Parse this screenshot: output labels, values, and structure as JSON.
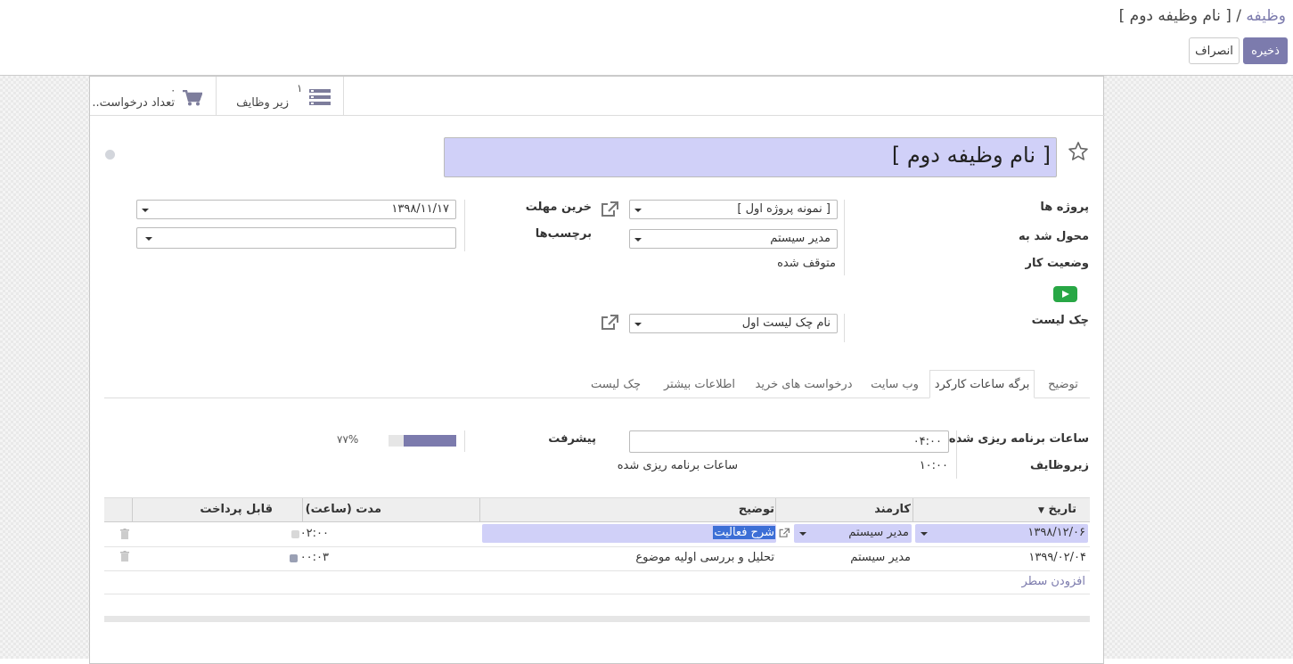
{
  "breadcrumb": {
    "parent": "وظیفه",
    "separator": " / ",
    "current": "[ نام وظیفه دوم ]"
  },
  "buttons": {
    "save": "ذخیره",
    "discard": "انصراف"
  },
  "stat_buttons": [
    {
      "icon": "list-icon",
      "count": "۱",
      "label": "زیر وظایف"
    },
    {
      "icon": "cart-icon",
      "count": "۰",
      "label": "تعداد درخواست.."
    }
  ],
  "title": "[ نام وظیفه دوم ]",
  "fields": {
    "project_label": "پروژه ها",
    "project_value": "[ نمونه پروژه اول ]",
    "assigned_label": "محول شد به",
    "assigned_value": "مدیر سیستم",
    "stage_label": "وضعیت کار",
    "stage_value": "متوقف شده",
    "checklist_label": "چک لیست",
    "checklist_value": "نام چک لیست اول",
    "deadline_label": "خرین مهلت",
    "deadline_value": "۱۳۹۸/۱۱/۱۷",
    "tags_label": "برچسب‌ها",
    "tags_value": ""
  },
  "tabs": [
    "توضیح",
    "برگه ساعات کارکرد",
    "وب سایت",
    "درخواست های خرید",
    "اطلاعات بیشتر",
    "چک لیست"
  ],
  "active_tab": "برگه ساعات کارکرد",
  "timesheet": {
    "planned_label": "ساعات برنامه ریزی شده",
    "planned_value": "۰۴:۰۰",
    "subtasks_label": "زیروظایف",
    "subtasks_value": "۱۰:۰۰",
    "subtasks_suffix": "ساعات برنامه ریزی شده",
    "progress_label": "پیشرفت",
    "progress_value": "۷۷%",
    "progress_fraction": 0.77
  },
  "table": {
    "headers": {
      "date": "تاریخ",
      "employee": "کارمند",
      "description": "توضیح",
      "duration": "مدت (ساعت)",
      "billable": "قابل پرداخت"
    },
    "rows": [
      {
        "date": "۱۳۹۸/۱۲/۰۶",
        "employee": "مدیر سیستم",
        "description": "شرح فعالیت",
        "duration": "۰۲:۰۰"
      },
      {
        "date": "۱۳۹۹/۰۲/۰۴",
        "employee": "مدیر سیستم",
        "description": "تحلیل و بررسی اولیه موضوع",
        "duration": "۰۰:۰۳"
      }
    ],
    "add_line": "افزودن سطر"
  },
  "colors": {
    "primary": "#7c7bad",
    "title_bg": "#d0d0f8",
    "status_green": "#28a745"
  }
}
